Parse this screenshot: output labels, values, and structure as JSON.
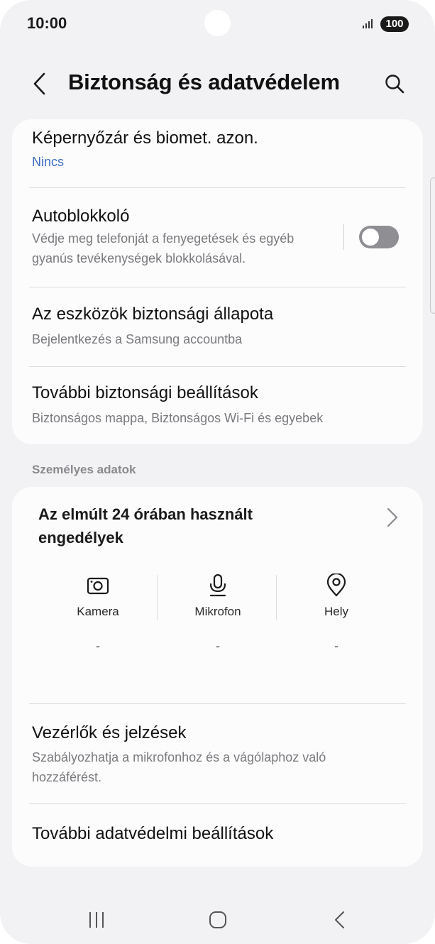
{
  "status_bar": {
    "time": "10:00",
    "battery": "100"
  },
  "header": {
    "title": "Biztonság és adatvédelem"
  },
  "security_card": {
    "items": [
      {
        "title": "Képernyőzár és biomet. azon.",
        "subtitle": "Nincs"
      },
      {
        "title": "Autoblokkoló",
        "subtitle": "Védje meg telefonját a fenyegetések és egyéb gyanús tevékenységek blokkolásával.",
        "toggle_on": false
      },
      {
        "title": "Az eszközök biztonsági állapota",
        "subtitle": "Bejelentkezés a Samsung accountba"
      },
      {
        "title": "További biztonsági beállítások",
        "subtitle": "Biztonságos mappa, Biztonságos Wi-Fi és egyebek"
      }
    ]
  },
  "personal_section": {
    "label": "Személyes adatok"
  },
  "permissions_card": {
    "title": "Az elmúlt 24 órában használt engedélyek",
    "columns": [
      {
        "icon": "camera-icon",
        "label": "Kamera",
        "value": "-"
      },
      {
        "icon": "microphone-icon",
        "label": "Mikrofon",
        "value": "-"
      },
      {
        "icon": "location-pin-icon",
        "label": "Hely",
        "value": "-"
      }
    ],
    "items": [
      {
        "title": "Vezérlők és jelzések",
        "subtitle": "Szabályozhatja a mikrofonhoz és a vágólaphoz való hozzáférést."
      },
      {
        "title": "További adatvédelmi beállítások"
      }
    ]
  },
  "colors": {
    "background": "#f2f2f4",
    "card": "#fcfcfd",
    "accent_blue": "#3e6fc4",
    "toggle_off": "#8e8e93"
  }
}
